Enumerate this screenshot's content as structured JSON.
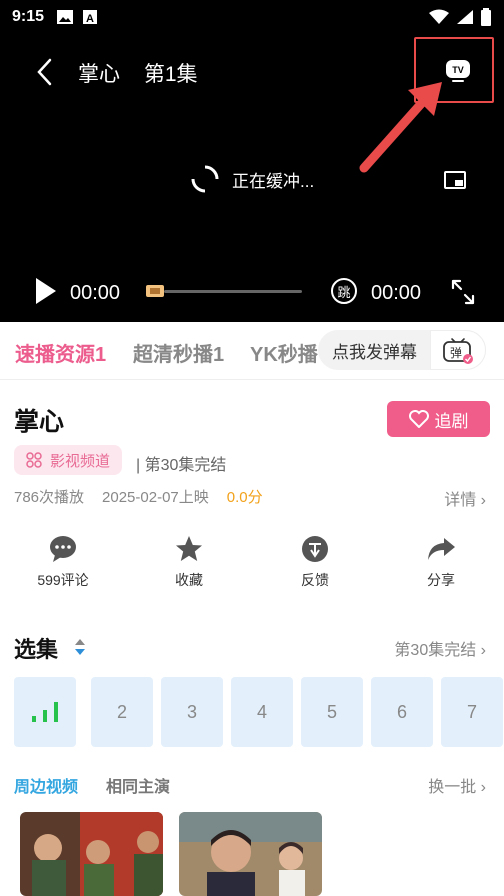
{
  "status": {
    "time": "9:15"
  },
  "player": {
    "show_title": "掌心",
    "episode": "第1集",
    "buffering_text": "正在缓冲...",
    "current_time": "00:00",
    "end_time": "00:00",
    "skip_label": "跳"
  },
  "sources": {
    "tabs": [
      "速播资源1",
      "超清秒播1",
      "YK秒播"
    ],
    "active_index": 0,
    "danmu_placeholder": "点我发弹幕",
    "danmu_button": "弹"
  },
  "info": {
    "title": "掌心",
    "follow_label": "追剧",
    "channel": "影视频道",
    "episode_status": "| 第30集完结",
    "plays": "786次播放",
    "release": "2025-02-07上映",
    "score": "0.0分",
    "detail_label": "详情 ›"
  },
  "actions": [
    {
      "icon": "comment-icon",
      "label": "599评论"
    },
    {
      "icon": "star-icon",
      "label": "收藏"
    },
    {
      "icon": "feedback-icon",
      "label": "反馈"
    },
    {
      "icon": "share-icon",
      "label": "分享"
    }
  ],
  "episodes": {
    "heading": "选集",
    "status": "第30集完结 ›",
    "items": [
      "",
      "2",
      "3",
      "4",
      "5",
      "6",
      "7"
    ]
  },
  "related": {
    "tabs": [
      "周边视频",
      "相同主演"
    ],
    "refresh_label": "换一批 ›"
  },
  "colors": {
    "accent_pink": "#f05d8a",
    "accent_blue": "#34a6e0",
    "annotation_red": "#e94a4a",
    "score_orange": "#f2a21b"
  }
}
